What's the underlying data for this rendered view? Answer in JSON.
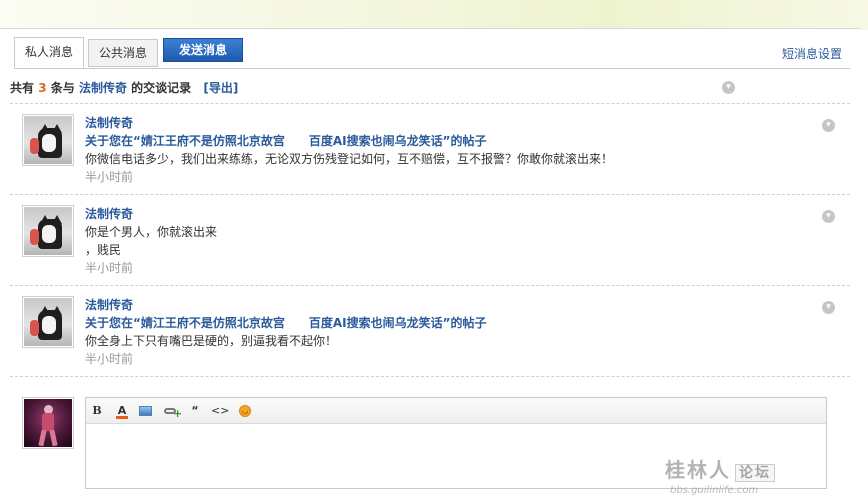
{
  "tabs": {
    "private_label": "私人消息",
    "public_label": "公共消息",
    "send_label": "发送消息"
  },
  "settings_link": "短消息设置",
  "summary": {
    "prefix": "共有",
    "count": "3",
    "middle": "条与",
    "partner": "法制传奇",
    "suffix": "的交谈记录",
    "export": "[导出]"
  },
  "messages": [
    {
      "sender": "法制传奇",
      "subject": "关于您在“婧江王府不是仿照北京故宫　　百度AI搜索也闹乌龙笑话”的帖子",
      "content": "你微信电话多少，我们出来练练，无论双方伤残登记如何，互不赔偿，互不报警？你敢你就滚出来！",
      "time": "半小时前"
    },
    {
      "sender": "法制传奇",
      "subject": "",
      "content_line1": "你是个男人，你就滚出来",
      "content_line2": "，贱民",
      "time": "半小时前"
    },
    {
      "sender": "法制传奇",
      "subject": "关于您在“婧江王府不是仿照北京故宫　　百度AI搜索也闹乌龙笑话”的帖子",
      "content": "你全身上下只有嘴巴是硬的，别逼我看不起你！",
      "time": "半小时前"
    }
  ],
  "editor": {
    "bold": "B",
    "color": "A",
    "quote": "“",
    "code": "<>"
  },
  "watermark": {
    "main": "桂林人",
    "forum": "论坛",
    "sub": "bbs.guilinlife.com"
  },
  "colors": {
    "link": "#2a5a9a",
    "count": "#e06a28",
    "send_button": "#2a6cc4"
  }
}
